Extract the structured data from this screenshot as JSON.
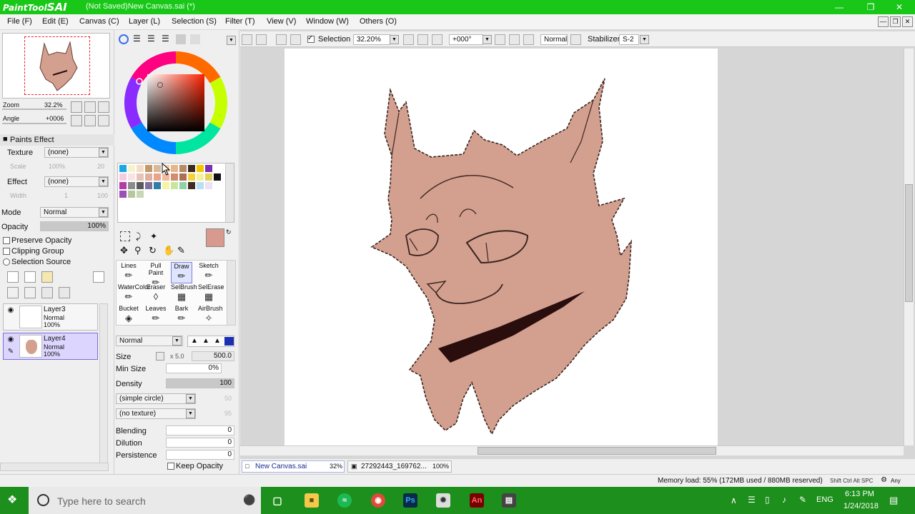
{
  "app": {
    "logo_text": "PaintTool",
    "logo_sai": "SAI",
    "title": "(Not Saved)New Canvas.sai (*)"
  },
  "menu": [
    "File (F)",
    "Edit (E)",
    "Canvas (C)",
    "Layer (L)",
    "Selection (S)",
    "Filter (T)",
    "View (V)",
    "Window (W)",
    "Others (O)"
  ],
  "navigator": {
    "zoom_label": "Zoom",
    "zoom_value": "32.2%",
    "angle_label": "Angle",
    "angle_value": "+0006"
  },
  "paints_effect": {
    "header": "Paints Effect",
    "texture_label": "Texture",
    "texture_value": "(none)",
    "scale_label": "Scale",
    "scale_value": "100%",
    "scale_num": "20",
    "effect_label": "Effect",
    "effect_value": "(none)",
    "width_label": "Width",
    "width_value": "1",
    "width_num": "100"
  },
  "blend": {
    "mode_label": "Mode",
    "mode_value": "Normal",
    "opacity_label": "Opacity",
    "opacity_value": "100%"
  },
  "checks": {
    "preserve_opacity": "Preserve Opacity",
    "clipping_group": "Clipping Group",
    "selection_source": "Selection Source"
  },
  "layers": [
    {
      "name": "Layer3",
      "mode": "Normal",
      "opacity": "100%"
    },
    {
      "name": "Layer4",
      "mode": "Normal",
      "opacity": "100%"
    }
  ],
  "tools": [
    {
      "label": "Lines"
    },
    {
      "label": "Pull Paint"
    },
    {
      "label": "Draw"
    },
    {
      "label": "Sketch"
    },
    {
      "label": "WaterColor"
    },
    {
      "label": "Eraser"
    },
    {
      "label": "SelBrush"
    },
    {
      "label": "SelErase"
    },
    {
      "label": "Bucket"
    },
    {
      "label": "Leaves"
    },
    {
      "label": "Bark"
    },
    {
      "label": "AirBrush"
    }
  ],
  "brush": {
    "mode_value": "Normal",
    "size_label": "Size",
    "size_mult": "x 5.0",
    "size_value": "500.0",
    "min_size_label": "Min Size",
    "min_size_value": "0%",
    "density_label": "Density",
    "density_value": "100",
    "shape_value": "(simple circle)",
    "shape_num": "50",
    "texture_value": "(no texture)",
    "texture_num": "95",
    "blending_label": "Blending",
    "blending_value": "0",
    "dilution_label": "Dilution",
    "dilution_value": "0",
    "persistence_label": "Persistence",
    "persistence_value": "0",
    "keep_opacity_label": "Keep Opacity"
  },
  "toolbar": {
    "selection_label": "Selection",
    "zoom_value": "32.20%",
    "angle_value": "+000°",
    "blend_value": "Normal",
    "stabilizer_label": "Stabilizer",
    "stabilizer_value": "S-2"
  },
  "docs": [
    {
      "name": "New Canvas.sai",
      "zoom": "32%"
    },
    {
      "name": "27292443_169762...",
      "zoom": "100%"
    }
  ],
  "status": {
    "memory": "Memory load: 55% (172MB used / 880MB reserved)",
    "keys": "Shift Ctrl Alt SPC",
    "any": "Any"
  },
  "taskbar": {
    "search_placeholder": "Type here to search",
    "lang": "ENG",
    "time": "6:13 PM",
    "date": "1/24/2018"
  },
  "colors": {
    "titlebar": "#18c718",
    "taskbar": "#1c8f1c",
    "current_color": "#d89a8e",
    "cat_fill": "#d3a08f",
    "line": "#3a2420",
    "collar": "#2a0d0d"
  }
}
